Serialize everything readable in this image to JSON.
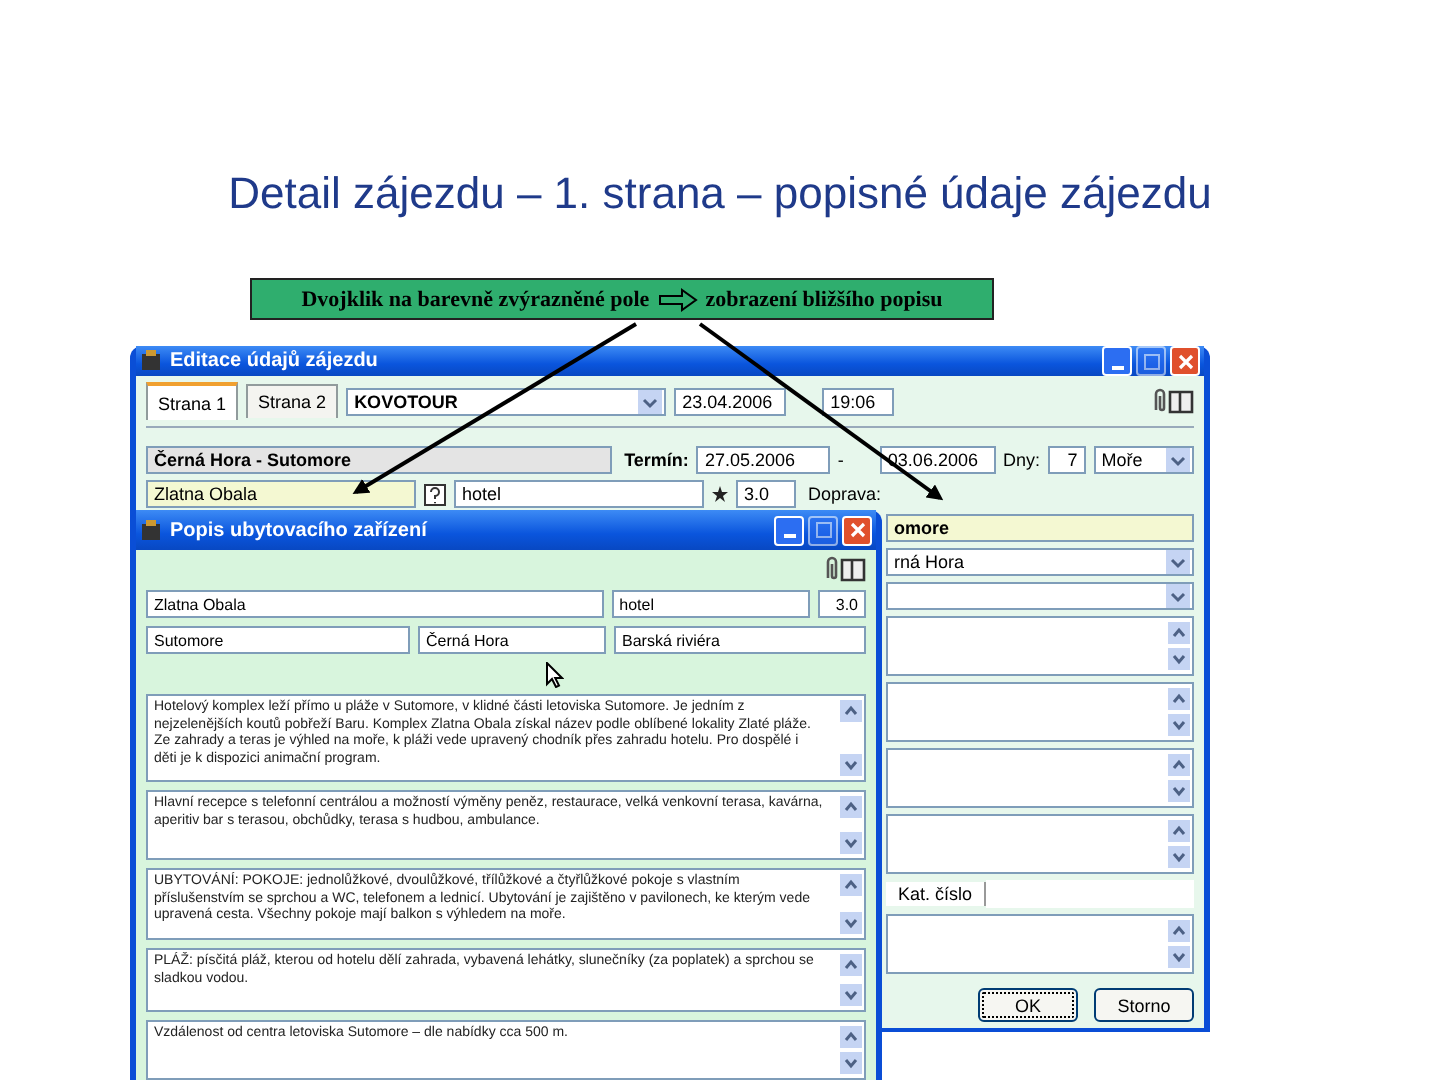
{
  "slide_title": "Detail zájezdu – 1. strana – popisné údaje zájezdu",
  "hint": {
    "before": "Dvojklik na barevně zvýrazněné pole",
    "after": "zobrazení bližšího popisu"
  },
  "main_window": {
    "title": "Editace údajů zájezdu",
    "tabs": [
      {
        "label": "Strana 1",
        "selected": true
      },
      {
        "label": "Strana 2",
        "selected": false
      }
    ],
    "agency": "KOVOTOUR",
    "date": "23.04.2006",
    "time": "19:06",
    "destination": "Černá Hora - Sutomore",
    "term_label": "Termín:",
    "date_from": "27.05.2006",
    "dash": "-",
    "date_to": "03.06.2006",
    "days_label": "Dny:",
    "days": "7",
    "trip_type": "Moře",
    "hotel_name": "Zlatna Obala",
    "category": "hotel",
    "rating": "3.0",
    "transport_label": "Doprava:",
    "resort_part": "omore",
    "country_part": "rná Hora",
    "catalog_label": "Kat. číslo",
    "buttons": [
      {
        "label": "OK",
        "focused": true
      },
      {
        "label": "Storno",
        "focused": false
      }
    ]
  },
  "detail_window": {
    "title": "Popis ubytovacího zařízení",
    "name": "Zlatna Obala",
    "category": "hotel",
    "rating": "3.0",
    "resort": "Sutomore",
    "country": "Černá Hora",
    "region": "Barská riviéra",
    "descriptions": [
      "Hotelový komplex leží přímo u pláže v Sutomore, v klidné části letoviska Sutomore. Je jedním z nejzelenějších koutů pobřeží Baru. Komplex Zlatna Obala získal název podle oblíbené lokality Zlaté pláže. Ze zahrady a teras je výhled na moře, k pláži vede upravený chodník přes zahradu hotelu. Pro dospělé i děti je k dispozici animační program.",
      "Hlavní recepce s telefonní centrálou a možností výměny peněz, restaurace, velká venkovní terasa, kavárna, aperitiv bar s terasou, obchůdky, terasa s hudbou, ambulance.",
      "UBYTOVÁNÍ: POKOJE: jednolůžkové, dvoulůžkové, třílůžkové a čtyřlůžkové pokoje s vlastním příslušenstvím se sprchou a WC, telefonem a lednicí. Ubytování je zajištěno v pavilonech, ke kterým vede upravená cesta. Všechny pokoje mají balkon s výhledem na moře.",
      "PLÁŽ: písčitá pláž, kterou od hotelu dělí zahrada, vybavená lehátky, slunečníky (za poplatek) a sprchou se sladkou vodou.",
      "Vzdálenost od centra letoviska Sutomore – dle nabídky cca 500 m."
    ]
  }
}
